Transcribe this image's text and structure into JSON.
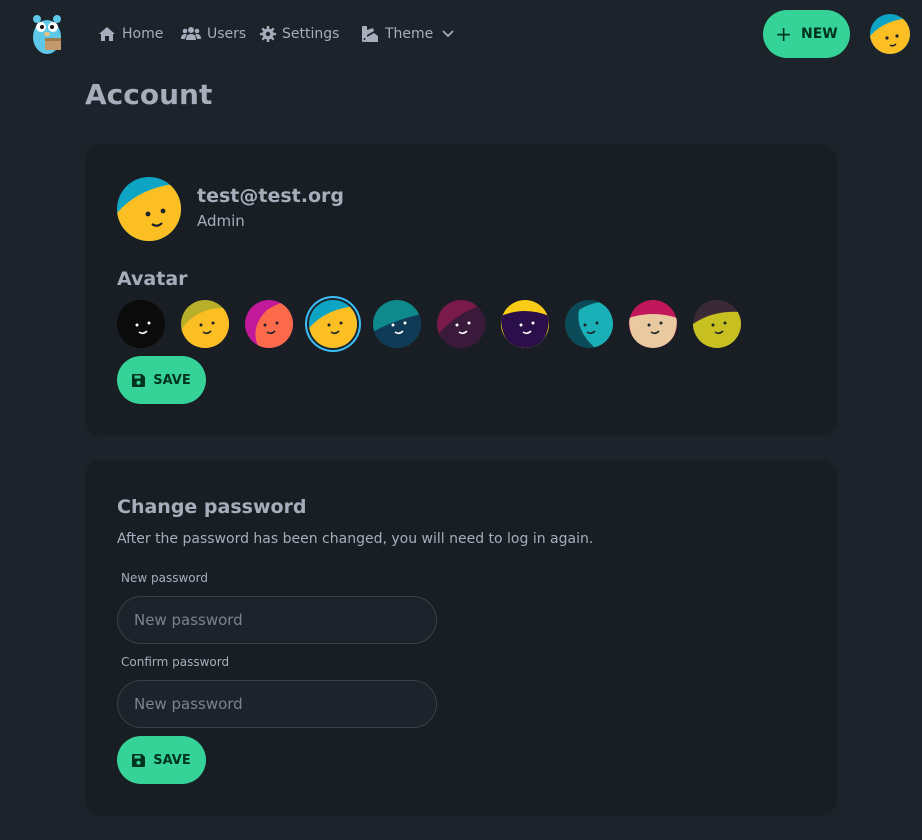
{
  "nav": {
    "home": "Home",
    "users": "Users",
    "settings": "Settings",
    "theme": "Theme",
    "new_label": "NEW"
  },
  "page": {
    "title": "Account"
  },
  "profile": {
    "email": "test@test.org",
    "role": "Admin"
  },
  "avatar_section": {
    "title": "Avatar",
    "save_label": "SAVE",
    "selected_index": 3,
    "avatars": [
      {
        "bg": "#0b0b0b",
        "face": "#0b0b0b",
        "eyes": "#ffffff"
      },
      {
        "bg": "#b8b02a",
        "face": "#fbbf24",
        "eyes": "#1d232a"
      },
      {
        "bg": "#c2199a",
        "face": "#fb6a4a",
        "eyes": "#1d232a"
      },
      {
        "bg": "#0ea5c5",
        "face": "#fbbf24",
        "eyes": "#1d232a"
      },
      {
        "bg": "#0e8a8c",
        "face": "#0f3b57",
        "eyes": "#ffffff"
      },
      {
        "bg": "#7a1a4a",
        "face": "#3a1a3a",
        "eyes": "#ffffff"
      },
      {
        "bg": "#facc15",
        "face": "#2a0f4a",
        "eyes": "#ffffff"
      },
      {
        "bg": "#0b4a57",
        "face": "#1ab0b8",
        "eyes": "#1d232a"
      },
      {
        "bg": "#c2185b",
        "face": "#e8c9a0",
        "eyes": "#1d232a"
      },
      {
        "bg": "#3a2a36",
        "face": "#c8c020",
        "eyes": "#1d232a"
      }
    ]
  },
  "password_section": {
    "title": "Change password",
    "description": "After the password has been changed, you will need to log in again.",
    "new_label": "New password",
    "new_placeholder": "New password",
    "confirm_label": "Confirm password",
    "confirm_placeholder": "New password",
    "save_label": "SAVE"
  },
  "colors": {
    "accent": "#36d399",
    "background": "#1d232a",
    "card": "#191e24",
    "selected_ring": "#3abff8"
  }
}
